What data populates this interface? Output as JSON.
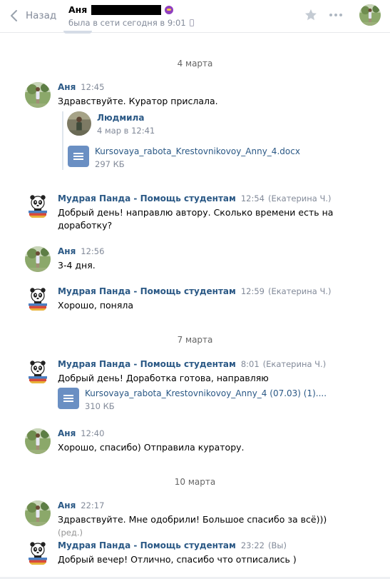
{
  "header": {
    "back_label": "Назад",
    "contact_name": "Аня",
    "status": "была в сети сегодня в 9:01",
    "icons": [
      "chevron-left-icon",
      "star-icon",
      "more-icon",
      "mobile-icon"
    ]
  },
  "colors": {
    "link": "#2a5885",
    "muted": "#828a99",
    "doc_icon": "#6a8fc3"
  },
  "dates": [
    "4 марта",
    "7 марта",
    "10 марта"
  ],
  "messages": [
    {
      "author": "Аня",
      "time": "12:45",
      "text": "Здравствуйте. Куратор прислала.",
      "forwarded": {
        "author": "Людмила",
        "date": "4 мар в 12:41",
        "doc": {
          "name": "Kursovaya_rabota_Krestovnikovoy_Anny_4.docx",
          "size": "297 КБ"
        }
      }
    },
    {
      "author": "Мудрая Панда - Помощь студентам",
      "time": "12:54",
      "sender": "(Екатерина Ч.)",
      "text": "Добрый день! направлю автору. Сколько времени есть на доработку?"
    },
    {
      "author": "Аня",
      "time": "12:56",
      "text": "3-4 дня."
    },
    {
      "author": "Мудрая Панда - Помощь студентам",
      "time": "12:59",
      "sender": "(Екатерина Ч.)",
      "text": "Хорошо, поняла"
    },
    {
      "author": "Мудрая Панда - Помощь студентам",
      "time": "8:01",
      "sender": "(Екатерина Ч.)",
      "text": "Добрый день! Доработка готова, направляю",
      "doc": {
        "name": "Kursovaya_rabota_Krestovnikovoy_Anny_4 (07.03) (1)....",
        "size": "310 КБ"
      }
    },
    {
      "author": "Аня",
      "time": "12:40",
      "text": "Хорошо, спасибо) Отправила куратору."
    },
    {
      "author": "Аня",
      "time": "22:17",
      "text": "Здравствуйте. Мне одобрили! Большое спасибо за всё)))",
      "edited": "(ред.)"
    },
    {
      "author": "Мудрая Панда - Помощь студентам",
      "time": "23:22",
      "sender": "(Вы)",
      "text": "Добрый вечер! Отлично, спасибо что отписались )"
    }
  ]
}
